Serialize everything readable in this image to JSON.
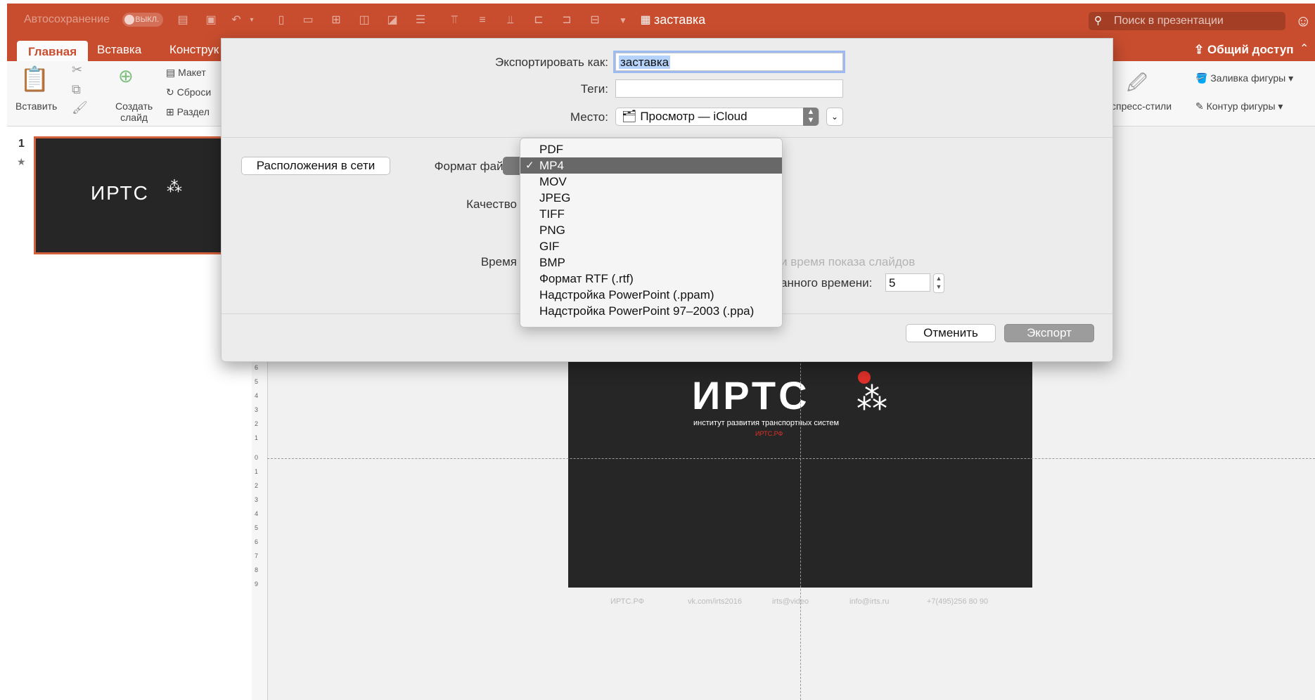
{
  "titlebar": {
    "autosave_label": "Автосохранение",
    "autosave_state": "ВЫКЛ.",
    "document_title": "заставка",
    "search_placeholder": "Поиск в презентации"
  },
  "ribbon": {
    "tabs": [
      "Главная",
      "Вставка",
      "Конструк"
    ],
    "share_label": "Общий доступ",
    "paste_label": "Вставить",
    "new_slide_label_1": "Создать",
    "new_slide_label_2": "слайд",
    "layout_label": "Макет",
    "reset_label": "Сброси",
    "section_label": "Раздел",
    "quick_styles_label": "спресс-стили",
    "shape_fill_label": "Заливка фигуры",
    "shape_outline_label": "Контур фигуры"
  },
  "slides_pane": {
    "slide_number": "1"
  },
  "slide": {
    "logo_text": "ИРТС",
    "subtitle": "институт развития транспортных систем",
    "url": "ИРТС.РФ",
    "footer": [
      "ИРТС.РФ",
      "vk.com/irts2016",
      "irts@video",
      "info@irts.ru",
      "+7(495)256 80 90"
    ]
  },
  "ruler_ticks": [
    "6",
    "5",
    "4",
    "3",
    "2",
    "1",
    "0",
    "1",
    "2",
    "3",
    "4",
    "5",
    "6",
    "7",
    "8",
    "9"
  ],
  "dialog": {
    "export_as_label": "Экспортировать как:",
    "export_as_value": "заставка",
    "tags_label": "Теги:",
    "tags_value": "",
    "location_label": "Место:",
    "location_value": "Просмотр — iCloud",
    "online_locations_button": "Расположения в сети",
    "file_format_label": "Формат файла",
    "quality_label": "Качество",
    "timing_label": "Время",
    "use_timings_text": "и время показа слайдов",
    "default_time_text": "анного времени:",
    "default_time_value": "5",
    "cancel_button": "Отменить",
    "export_button": "Экспорт"
  },
  "format_menu": {
    "selected": "MP4",
    "items": [
      "PDF",
      "MP4",
      "MOV",
      "JPEG",
      "TIFF",
      "PNG",
      "GIF",
      "BMP",
      "Формат RTF (.rtf)",
      "Надстройка PowerPoint (.ppam)",
      "Надстройка PowerPoint 97–2003 (.ppa)"
    ]
  },
  "colors": {
    "accent": "#c84d2e",
    "slide_background": "#262626",
    "logo_dot": "#e0302a",
    "menu_selection": "#686868"
  }
}
